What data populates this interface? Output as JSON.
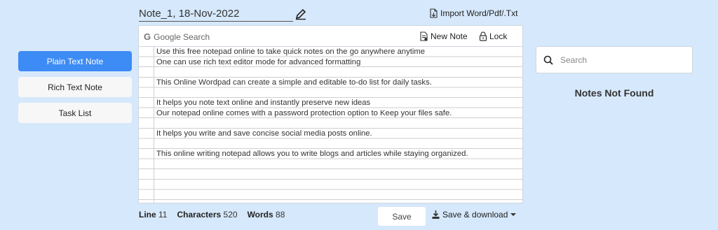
{
  "nav": {
    "plain_text_note": "Plain Text Note",
    "rich_text_note": "Rich Text Note",
    "task_list": "Task List"
  },
  "note": {
    "title": "Note_1, 18-Nov-2022"
  },
  "toolbar": {
    "import_label": "Import Word/Pdf/.Txt",
    "google_search": "Google Search",
    "google_letter": "G",
    "new_note": "New Note",
    "lock": "Lock"
  },
  "editor_lines": [
    "Use this free notepad online to take quick notes on the go anywhere anytime",
    "One can use rich text editor mode for advanced formatting",
    "",
    "This Online Wordpad can create a simple and editable to-do list for daily tasks.",
    "",
    "It helps you note text online and instantly preserve new ideas",
    "Our notepad online comes with a password protection option to Keep your files safe.",
    "",
    "It helps you write and save concise social media posts online.",
    "",
    "This online writing notepad allows you to write blogs and articles while staying organized.",
    "",
    "",
    "",
    "",
    ""
  ],
  "stats": {
    "line_label": "Line",
    "line_value": "11",
    "chars_label": "Characters",
    "chars_value": "520",
    "words_label": "Words",
    "words_value": "88"
  },
  "actions": {
    "save": "Save",
    "save_download": "Save & download"
  },
  "search": {
    "placeholder": "Search"
  },
  "notes_status": "Notes Not Found"
}
